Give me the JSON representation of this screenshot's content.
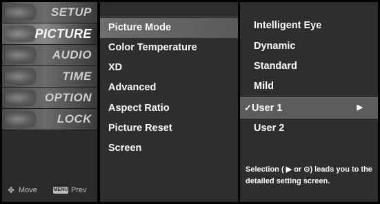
{
  "categories": [
    {
      "label": "SETUP"
    },
    {
      "label": "PICTURE"
    },
    {
      "label": "AUDIO"
    },
    {
      "label": "TIME"
    },
    {
      "label": "OPTION"
    },
    {
      "label": "LOCK"
    }
  ],
  "hints": {
    "move_label": "Move",
    "menu_key": "MENU",
    "prev_label": "Prev"
  },
  "submenu": {
    "items": [
      {
        "label": "Picture Mode"
      },
      {
        "label": "Color Temperature"
      },
      {
        "label": "XD"
      },
      {
        "label": "Advanced"
      },
      {
        "label": "Aspect Ratio"
      },
      {
        "label": "Picture Reset"
      },
      {
        "label": "Screen"
      }
    ]
  },
  "options": {
    "items": [
      {
        "label": "Intelligent Eye"
      },
      {
        "label": "Dynamic"
      },
      {
        "label": "Standard"
      },
      {
        "label": "Mild"
      },
      {
        "label": "User 1"
      },
      {
        "label": "User 2"
      }
    ],
    "checkmark": "✓",
    "arrow": "▶",
    "note": "Selection ( ▶ or ⊙) leads you  to the detailed setting screen."
  }
}
